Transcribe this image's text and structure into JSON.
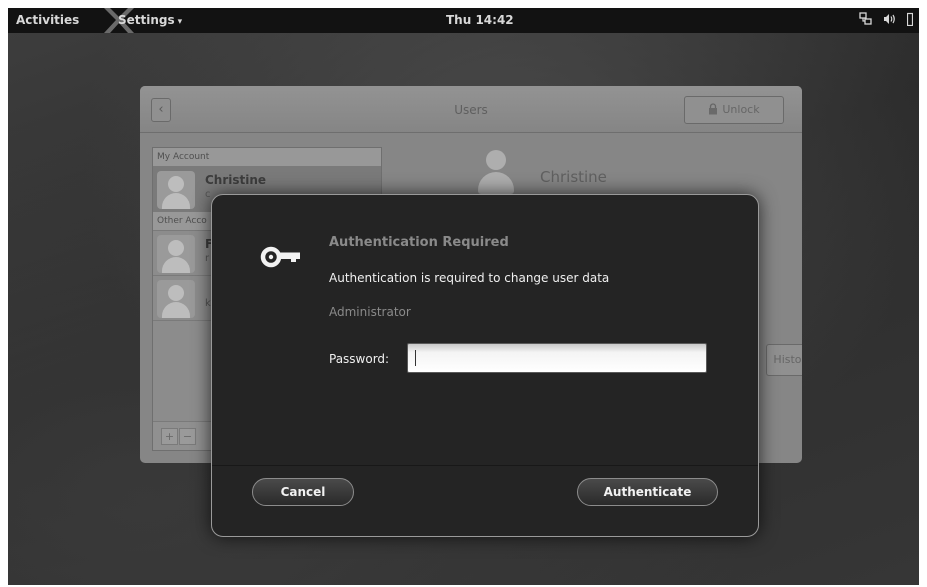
{
  "topbar": {
    "activities": "Activities",
    "app_menu": "Settings",
    "app_menu_arrow": "▾",
    "clock": "Thu 14:42",
    "tray_icons": [
      "network-icon",
      "volume-icon",
      "battery-icon"
    ]
  },
  "users_window": {
    "title": "Users",
    "back_glyph": "‹",
    "unlock_label": "Unlock",
    "close_glyph": "×",
    "my_account_header": "My Account",
    "other_accounts_header": "Other Acco",
    "accounts": [
      {
        "name": "Christine",
        "sub": "c",
        "selected": true
      },
      {
        "name": "F",
        "sub": "r"
      },
      {
        "name": "",
        "sub": "k"
      }
    ],
    "add_glyph": "+",
    "remove_glyph": "−",
    "detail_name": "Christine",
    "history_label": "History"
  },
  "auth_dialog": {
    "heading": "Authentication Required",
    "message": "Authentication is required to change user data",
    "user": "Administrator",
    "password_label": "Password:",
    "password_value": "",
    "cancel_label": "Cancel",
    "authenticate_label": "Authenticate"
  },
  "colors": {
    "topbar_bg": "#121212",
    "dialog_bg": "#242424",
    "dialog_border": "#9a9a9a",
    "heading_gray": "#8a8a8a"
  }
}
